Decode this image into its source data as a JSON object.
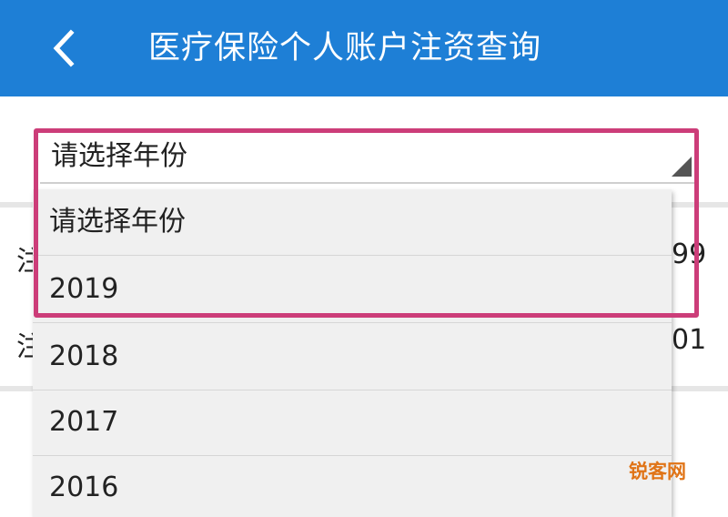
{
  "header": {
    "title": "医疗保险个人账户注资查询",
    "back_icon": "chevron-left-icon",
    "background_color": "#1e7fd6"
  },
  "select": {
    "selected_label": "请选择年份",
    "arrow_icon": "dropdown-triangle-icon"
  },
  "dropdown": {
    "options": [
      {
        "label": "请选择年份"
      },
      {
        "label": "2019"
      },
      {
        "label": "2018"
      },
      {
        "label": "2017"
      },
      {
        "label": "2016"
      }
    ]
  },
  "underlay": {
    "row1_left": "注",
    "row1_right": "99",
    "row2_left": "注",
    "row2_right": "01"
  },
  "highlight_color": "#cc3d79",
  "watermark": "锐客网"
}
